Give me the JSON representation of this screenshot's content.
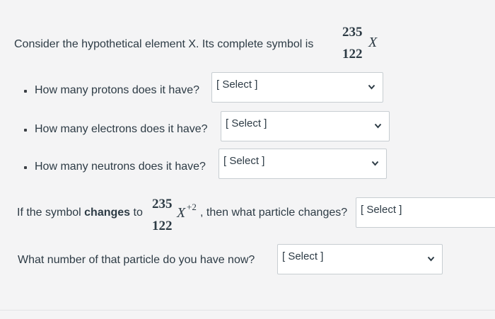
{
  "q1": {
    "prefix": "Consider the hypothetical element X. Its complete symbol is",
    "mass": "235",
    "atomic": "122",
    "symbol": "X"
  },
  "questions": [
    {
      "text": "How many protons does it have?",
      "select": "[ Select ]"
    },
    {
      "text": "How many electrons does it have?",
      "select": "[ Select ]"
    },
    {
      "text": "How many neutrons does it have?",
      "select": "[ Select ]"
    }
  ],
  "q2": {
    "prefix_plain": "If the symbol ",
    "prefix_bold": "changes",
    "prefix_plain2": " to",
    "mass": "235",
    "atomic": "122",
    "symbol": "X",
    "charge": "+2",
    "suffix": ", then what particle changes?",
    "select": "[ Select ]"
  },
  "q3": {
    "text": "What number of that particle do you have now?",
    "select": "[ Select ]"
  },
  "icons": {
    "chevron": "chevron-down-icon"
  },
  "colors": {
    "text": "#2d3b45",
    "border": "#c7cdd1",
    "background": "#f4f4f5"
  }
}
